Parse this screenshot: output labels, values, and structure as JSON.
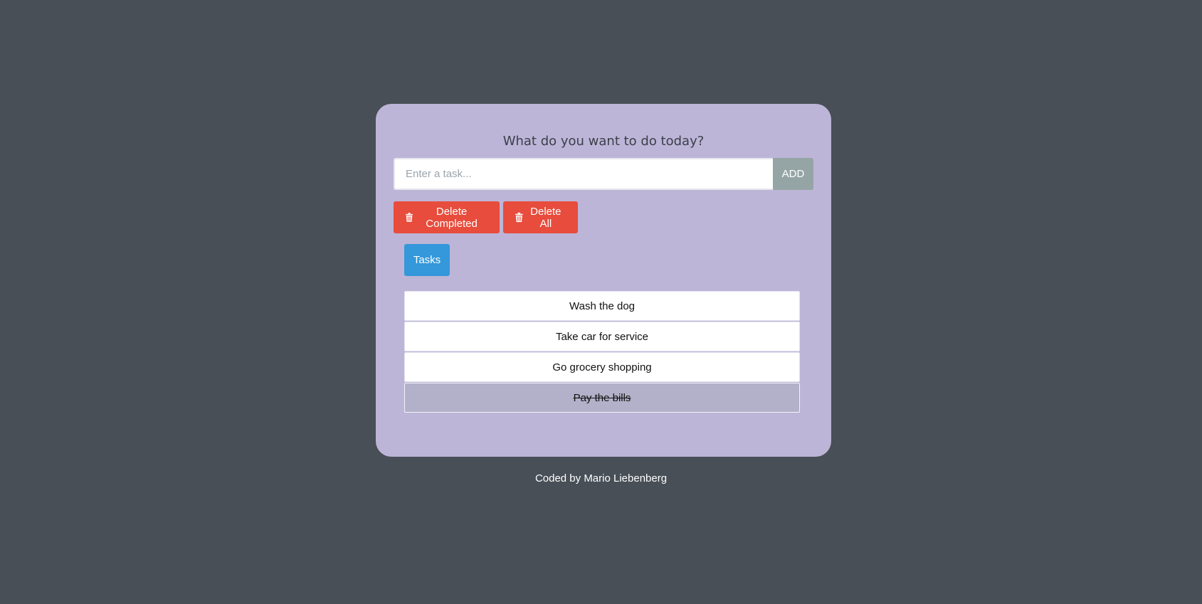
{
  "app": {
    "heading": "What do you want to do today?",
    "input_placeholder": "Enter a task...",
    "input_value": "",
    "add_label": "ADD",
    "delete_completed_label": "Delete Completed",
    "delete_all_label": "Delete All",
    "tasks_tab_label": "Tasks"
  },
  "tasks": [
    {
      "text": "Wash the dog",
      "completed": false
    },
    {
      "text": "Take car for service",
      "completed": false
    },
    {
      "text": "Go grocery shopping",
      "completed": false
    },
    {
      "text": "Pay the bills",
      "completed": true
    }
  ],
  "footer": {
    "credit": "Coded by Mario Liebenberg"
  },
  "colors": {
    "page_background": "#484f57",
    "card_background": "#bdb5d7",
    "add_button": "#95a5a6",
    "danger": "#e74c3c",
    "primary": "#3498db",
    "completed_task": "#b3b1c9"
  },
  "icons": {
    "delete_completed_icon": "trash-icon",
    "delete_all_icon": "trash-icon"
  }
}
